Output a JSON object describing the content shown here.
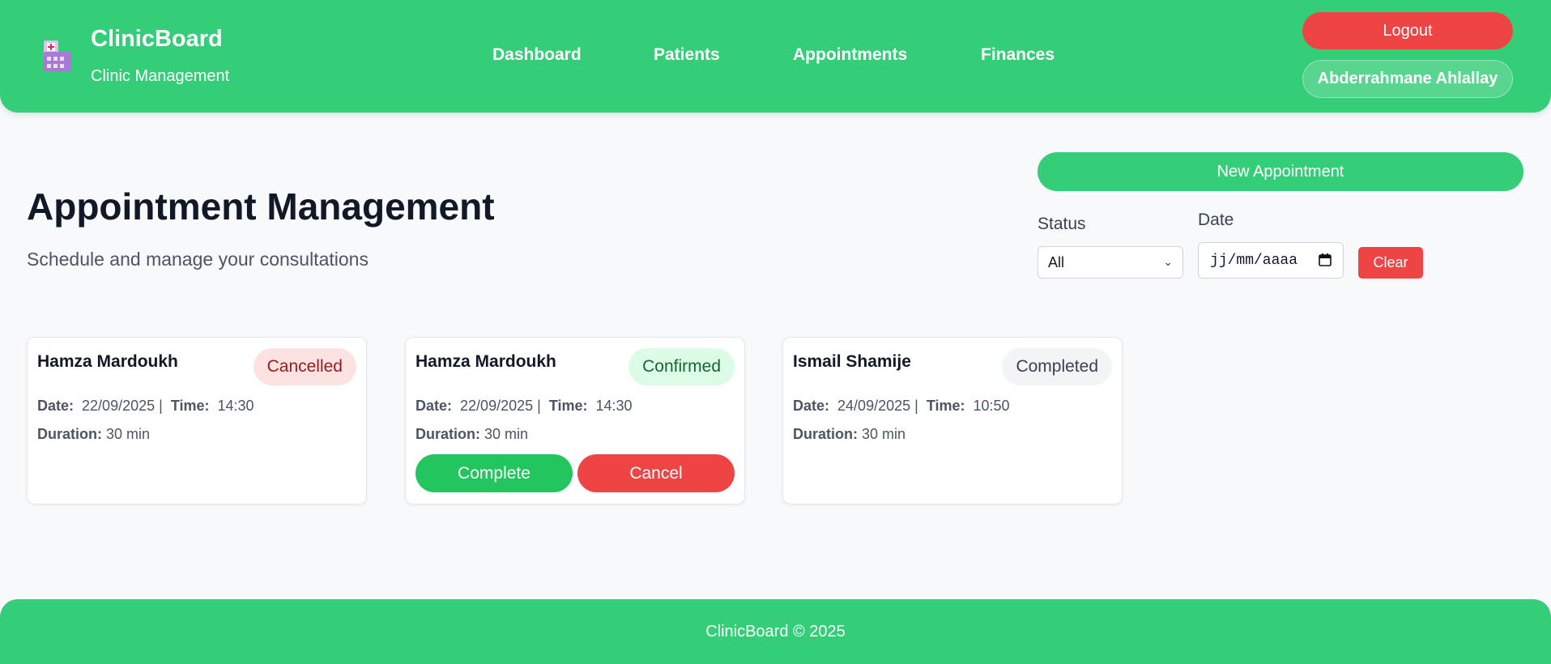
{
  "header": {
    "brand_title": "ClinicBoard",
    "brand_subtitle": "Clinic Management",
    "logo_icon": "clinic-building-icon",
    "nav": [
      "Dashboard",
      "Patients",
      "Appointments",
      "Finances"
    ],
    "logout_label": "Logout",
    "user_name": "Abderrahmane Ahlallay"
  },
  "page": {
    "title": "Appointment Management",
    "subtitle": "Schedule and manage your consultations"
  },
  "controls": {
    "new_appointment_label": "New Appointment",
    "status_label": "Status",
    "status_value": "All",
    "date_label": "Date",
    "date_placeholder": "jj/mm/aaaa",
    "clear_label": "Clear"
  },
  "appointments": [
    {
      "patient": "Hamza Mardoukh",
      "status": "Cancelled",
      "date_label": "Date:",
      "date": "22/09/2025",
      "time_label": "Time:",
      "time": "14:30",
      "duration_label": "Duration:",
      "duration": "30 min"
    },
    {
      "patient": "Hamza Mardoukh",
      "status": "Confirmed",
      "date_label": "Date:",
      "date": "22/09/2025",
      "time_label": "Time:",
      "time": "14:30",
      "duration_label": "Duration:",
      "duration": "30 min",
      "actions": [
        "Complete",
        "Cancel"
      ]
    },
    {
      "patient": "Ismail Shamije",
      "status": "Completed",
      "date_label": "Date:",
      "date": "24/09/2025",
      "time_label": "Time:",
      "time": "10:50",
      "duration_label": "Duration:",
      "duration": "30 min"
    }
  ],
  "footer": {
    "text": "ClinicBoard © 2025"
  },
  "colors": {
    "brand_green": "#34ce78",
    "danger_red": "#ef4444",
    "success_green": "#22c55e",
    "background": "#f8f9fb"
  }
}
